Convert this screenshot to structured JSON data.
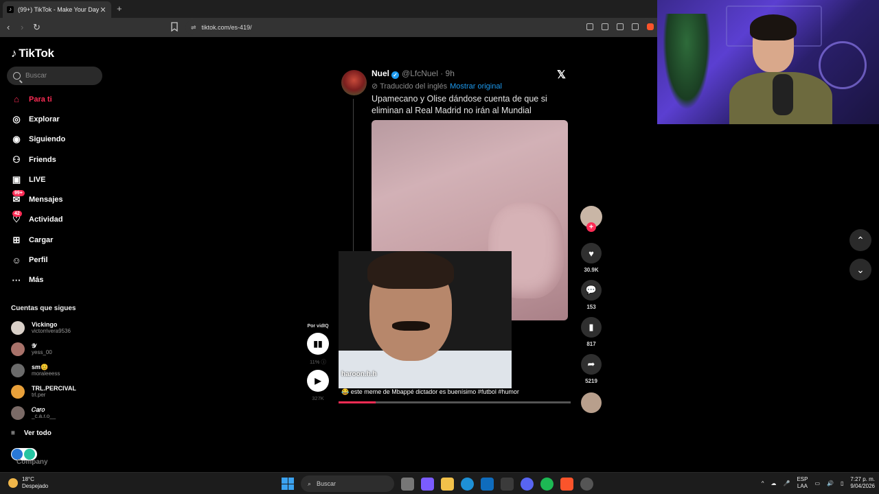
{
  "browser": {
    "tab_title": "(99+) TikTok - Make Your Day",
    "tab_close": "✕",
    "new_tab": "+",
    "url": "tiktok.com/es-419/"
  },
  "sidebar": {
    "logo": "TikTok",
    "search_placeholder": "Buscar",
    "nav": [
      {
        "label": "Para ti",
        "icon": "home-icon",
        "active": true
      },
      {
        "label": "Explorar",
        "icon": "compass-icon"
      },
      {
        "label": "Siguiendo",
        "icon": "following-icon"
      },
      {
        "label": "Friends",
        "icon": "friends-icon"
      },
      {
        "label": "LIVE",
        "icon": "live-icon"
      },
      {
        "label": "Mensajes",
        "icon": "messages-icon",
        "badge": "99+"
      },
      {
        "label": "Actividad",
        "icon": "activity-icon",
        "badge": "42"
      },
      {
        "label": "Cargar",
        "icon": "upload-icon"
      },
      {
        "label": "Perfil",
        "icon": "profile-icon"
      },
      {
        "label": "Más",
        "icon": "more-icon"
      }
    ],
    "following_title": "Cuentas que sigues",
    "following": [
      {
        "name": "Vickingo",
        "handle": "victorrivera9536",
        "color": "#d9d0c8"
      },
      {
        "name": "𝒴",
        "handle": "yess_00",
        "color": "#a8726a"
      },
      {
        "name": "sm😊",
        "handle": "moraleeess",
        "color": "#6b6b6b"
      },
      {
        "name": "TRL.PERCIVAL",
        "handle": "trl.per",
        "color": "#e8a03a"
      },
      {
        "name": "𝐶𝑎𝑟𝑜",
        "handle": "_c.a.r.o__",
        "color": "#7a6a66"
      }
    ],
    "see_all": "Ver todo",
    "company": "Company"
  },
  "post": {
    "author": "Nuel",
    "handle": "@LfcNuel · 9h",
    "translated": "Traducido del inglés",
    "show_original": "Mostrar original",
    "text": "Upamecano y Olise dándose cuenta de que si eliminan al Real Madrid no irán al Mundial",
    "video_user": "haroon.h.h",
    "caption": "😂 este meme de Mbappé dictador es buenísimo #futbol #humor",
    "progress": 0.16
  },
  "actions": {
    "likes": "30.9K",
    "comments": "153",
    "saves": "817",
    "shares": "5219"
  },
  "vidiq": {
    "label": "Por vidIQ",
    "percent": "11%",
    "views": "327K"
  },
  "taskbar": {
    "temp": "18°C",
    "weather": "Despejado",
    "search": "Buscar",
    "lang1": "ESP",
    "lang2": "LAA",
    "time": "7:27 p. m.",
    "date": "9/04/2026"
  },
  "colors": {
    "accent": "#fe2c55",
    "link": "#1d9bf0"
  }
}
